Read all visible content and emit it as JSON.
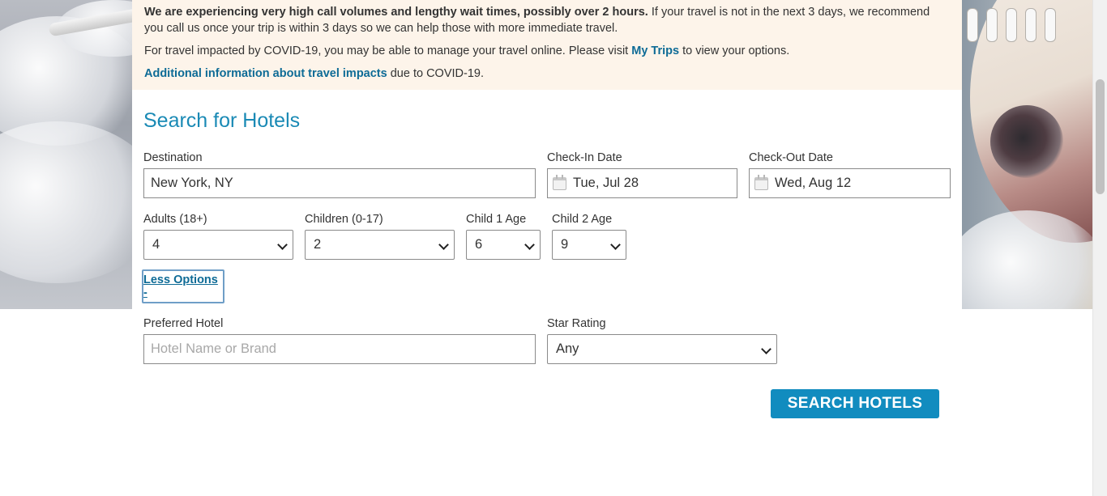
{
  "notice": {
    "line1_bold": "We are experiencing very high call volumes and lengthy wait times, possibly over 2 hours.",
    "line1_rest": " If your travel is not in the next 3 days, we recommend you call us once your trip is within 3 days so we can help those with more immediate travel.",
    "line2_pre": "For travel impacted by COVID-19, you may be able to manage your travel online. Please visit ",
    "line2_link": "My Trips",
    "line2_post": " to view your options.",
    "line3_link": "Additional information about travel impacts",
    "line3_post": " due to COVID-19."
  },
  "search": {
    "title": "Search for Hotels",
    "destination": {
      "label": "Destination",
      "value": "New York, NY"
    },
    "checkin": {
      "label": "Check-In Date",
      "value": "Tue, Jul 28"
    },
    "checkout": {
      "label": "Check-Out Date",
      "value": "Wed, Aug 12"
    },
    "adults": {
      "label": "Adults (18+)",
      "value": "4"
    },
    "children": {
      "label": "Children (0-17)",
      "value": "2"
    },
    "child1_age": {
      "label": "Child 1 Age",
      "value": "6"
    },
    "child2_age": {
      "label": "Child 2 Age",
      "value": "9"
    },
    "less_options_label": "Less Options -",
    "preferred_hotel": {
      "label": "Preferred Hotel",
      "value": "",
      "placeholder": "Hotel Name or Brand"
    },
    "star_rating": {
      "label": "Star Rating",
      "value": "Any"
    },
    "submit_label": "SEARCH HOTELS"
  },
  "colors": {
    "accent": "#1a8ab5",
    "link": "#0e6b96",
    "button": "#118cbf",
    "notice_bg": "#fdf4ea"
  },
  "icons": {
    "calendar": "calendar-icon",
    "dropdown": "chevron-down-icon"
  }
}
